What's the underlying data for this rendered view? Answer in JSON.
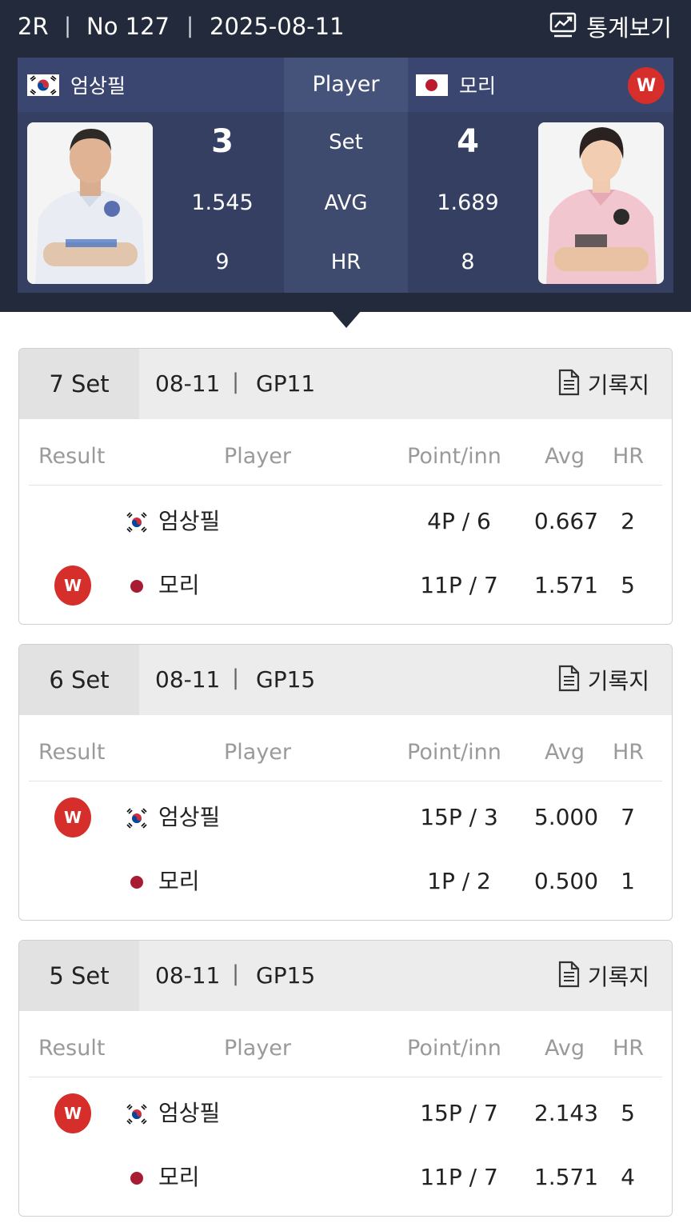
{
  "header": {
    "round": "2R",
    "match_no": "No 127",
    "date": "2025-08-11",
    "stats_label": "통계보기"
  },
  "scoreboard": {
    "center_head": "Player",
    "labels": {
      "set": "Set",
      "avg": "AVG",
      "hr": "HR"
    },
    "left": {
      "name": "엄상필",
      "country": "KR",
      "set": "3",
      "avg": "1.545",
      "hr": "9"
    },
    "right": {
      "name": "모리",
      "country": "JP",
      "set": "4",
      "avg": "1.689",
      "hr": "8",
      "winner_badge": "W"
    }
  },
  "table_headers": {
    "result": "Result",
    "player": "Player",
    "point": "Point/inn",
    "avg": "Avg",
    "hr": "HR"
  },
  "record_label": "기록지",
  "sets": [
    {
      "set_label": "7 Set",
      "date": "08-11",
      "table": "GP11",
      "rows": [
        {
          "result": "",
          "country": "KR",
          "name": "엄상필",
          "point": "4P / 6",
          "avg": "0.667",
          "hr": "2"
        },
        {
          "result": "W",
          "country": "JP",
          "name": "모리",
          "point": "11P / 7",
          "avg": "1.571",
          "hr": "5"
        }
      ]
    },
    {
      "set_label": "6 Set",
      "date": "08-11",
      "table": "GP15",
      "rows": [
        {
          "result": "W",
          "country": "KR",
          "name": "엄상필",
          "point": "15P / 3",
          "avg": "5.000",
          "hr": "7"
        },
        {
          "result": "",
          "country": "JP",
          "name": "모리",
          "point": "1P / 2",
          "avg": "0.500",
          "hr": "1"
        }
      ]
    },
    {
      "set_label": "5 Set",
      "date": "08-11",
      "table": "GP15",
      "rows": [
        {
          "result": "W",
          "country": "KR",
          "name": "엄상필",
          "point": "15P / 7",
          "avg": "2.143",
          "hr": "5"
        },
        {
          "result": "",
          "country": "JP",
          "name": "모리",
          "point": "11P / 7",
          "avg": "1.571",
          "hr": "4"
        }
      ]
    }
  ],
  "colors": {
    "header_bg": "#232a3b",
    "board_bg": "#343f62",
    "win_badge": "#d62e2a",
    "jp_dot": "#a81c33"
  }
}
